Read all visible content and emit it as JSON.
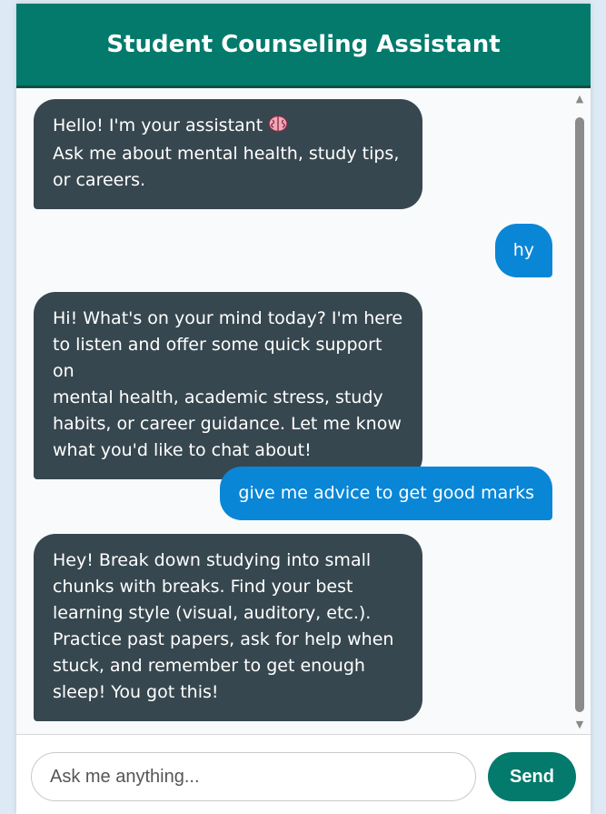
{
  "header": {
    "title": "Student Counseling Assistant"
  },
  "messages": [
    {
      "sender": "bot",
      "lines": [
        "Hello! I'm your assistant",
        "Ask me about mental health, study tips,",
        "or careers."
      ],
      "icon": "brain-icon"
    },
    {
      "sender": "user",
      "text": "hy"
    },
    {
      "sender": "bot",
      "lines": [
        "Hi! What's on your mind today? I'm here",
        "to listen and offer some quick support on",
        "mental health, academic stress, study",
        "habits, or career guidance. Let me know",
        "what you'd like to chat about!"
      ]
    },
    {
      "sender": "user",
      "text": "give me advice to get good marks"
    },
    {
      "sender": "bot",
      "lines": [
        "Hey! Break down studying into small",
        "chunks with breaks. Find your best",
        "learning style (visual, auditory, etc.).",
        "Practice past papers, ask for help when",
        "stuck, and remember to get enough",
        "sleep! You got this!"
      ]
    }
  ],
  "composer": {
    "placeholder": "Ask me anything...",
    "value": "",
    "send_label": "Send"
  },
  "colors": {
    "header": "#037a6b",
    "bot_bubble": "#37474f",
    "user_bubble": "#0a86d6",
    "send_button": "#037a6b"
  }
}
